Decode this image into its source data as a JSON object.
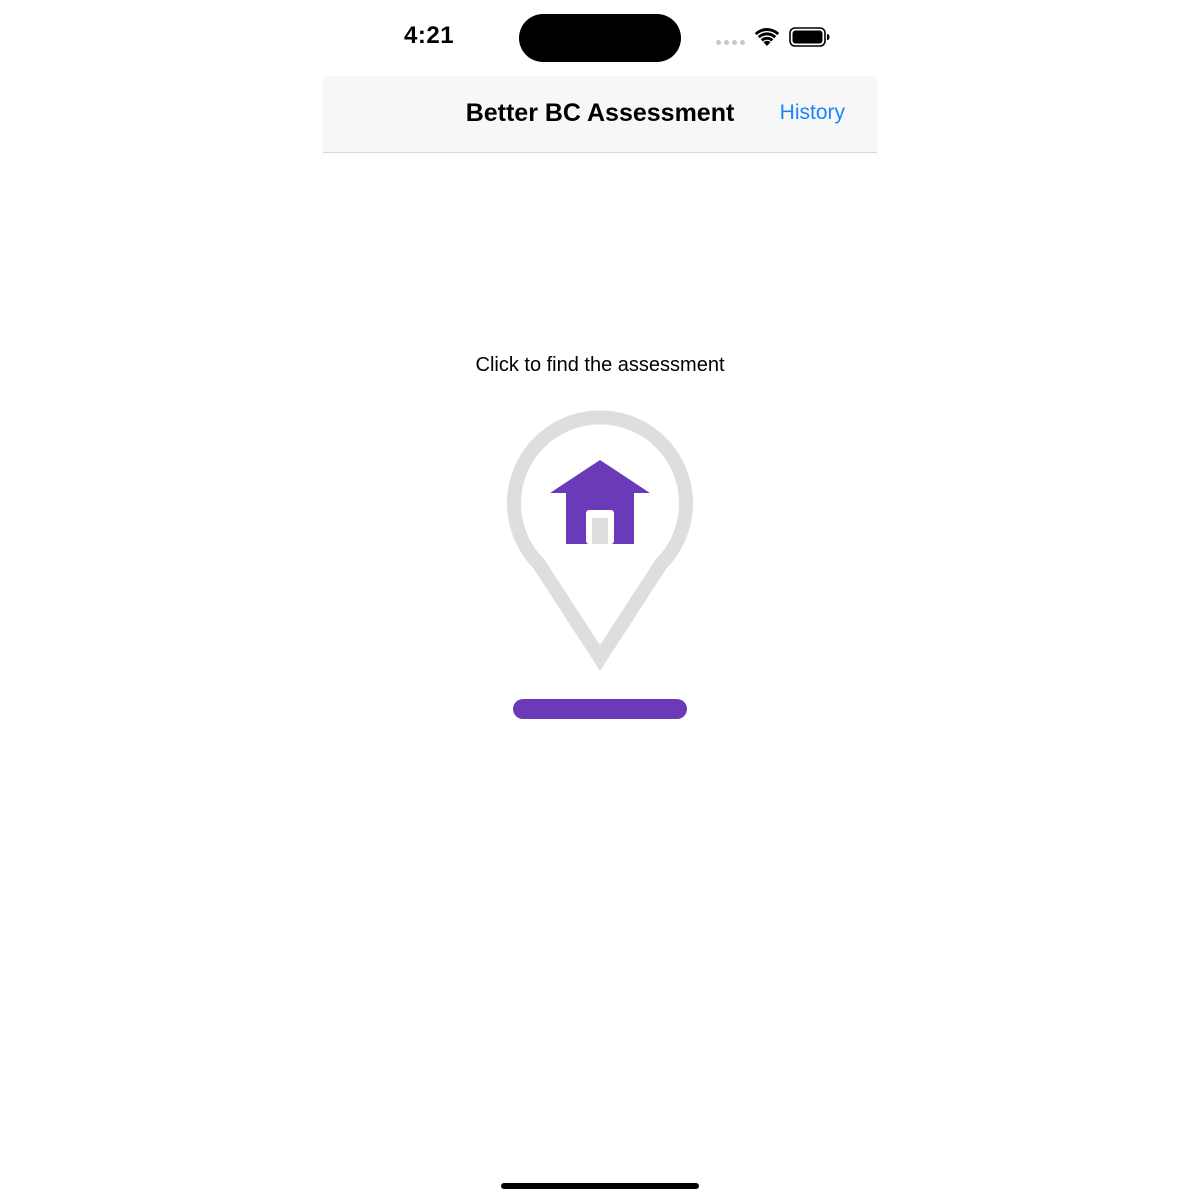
{
  "status_bar": {
    "time": "4:21"
  },
  "nav": {
    "title": "Better BC Assessment",
    "history_label": "History"
  },
  "main": {
    "prompt": "Click to find the assessment"
  },
  "colors": {
    "accent": "#6a3ab8",
    "link": "#1a84ff",
    "pin_outline": "#dedede"
  },
  "icons": {
    "pin": "location-pin-icon",
    "house": "house-icon",
    "wifi": "wifi-icon",
    "battery": "battery-icon"
  }
}
